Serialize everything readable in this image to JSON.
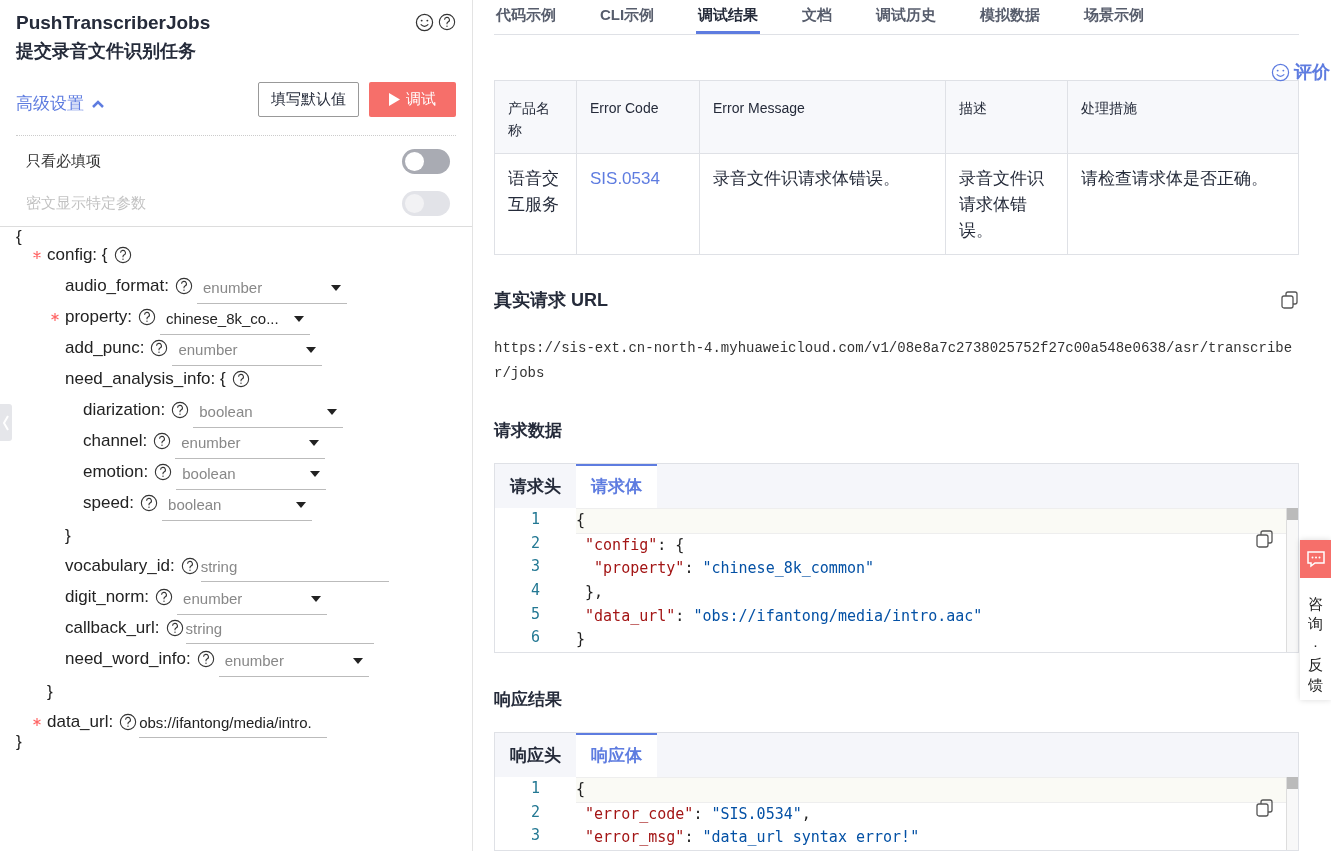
{
  "header": {
    "title": "PushTranscriberJobs",
    "subtitle": "提交录音文件识别任务"
  },
  "advanced": {
    "label": "高级设置",
    "expanded": true
  },
  "buttons": {
    "defaults": "填写默认值",
    "debug": "调试"
  },
  "toggles": [
    {
      "label": "只看必填项",
      "on": false,
      "disabled": false
    },
    {
      "label": "密文显示特定参数",
      "on": false,
      "disabled": true
    }
  ],
  "form": {
    "open": "{",
    "close": "}",
    "fields": [
      {
        "kind": "object",
        "label": "config: {",
        "required": true,
        "close": "}",
        "children": [
          {
            "kind": "select",
            "label": "audio_format:",
            "required": false,
            "placeholder": "enumber"
          },
          {
            "kind": "select",
            "label": "property:",
            "required": true,
            "value": "chinese_8k_co..."
          },
          {
            "kind": "select",
            "label": "add_punc:",
            "required": false,
            "placeholder": "enumber"
          },
          {
            "kind": "object",
            "label": "need_analysis_info: {",
            "required": false,
            "close": "}",
            "children": [
              {
                "kind": "select",
                "label": "diarization:",
                "required": false,
                "placeholder": "boolean"
              },
              {
                "kind": "select",
                "label": "channel:",
                "required": false,
                "placeholder": "enumber"
              },
              {
                "kind": "select",
                "label": "emotion:",
                "required": false,
                "placeholder": "boolean"
              },
              {
                "kind": "select",
                "label": "speed:",
                "required": false,
                "placeholder": "boolean"
              }
            ]
          },
          {
            "kind": "input",
            "label": "vocabulary_id:",
            "required": false,
            "placeholder": "string"
          },
          {
            "kind": "select",
            "label": "digit_norm:",
            "required": false,
            "placeholder": "enumber"
          },
          {
            "kind": "input",
            "label": "callback_url:",
            "required": false,
            "placeholder": "string"
          },
          {
            "kind": "select",
            "label": "need_word_info:",
            "required": false,
            "placeholder": "enumber"
          }
        ]
      },
      {
        "kind": "input",
        "label": "data_url:",
        "required": true,
        "value": "obs://ifantong/media/intro."
      }
    ]
  },
  "tabs": [
    {
      "label": "代码示例",
      "selected": false
    },
    {
      "label": "CLI示例",
      "selected": false
    },
    {
      "label": "调试结果",
      "selected": true
    },
    {
      "label": "文档",
      "selected": false
    },
    {
      "label": "调试历史",
      "selected": false
    },
    {
      "label": "模拟数据",
      "selected": false
    },
    {
      "label": "场景示例",
      "selected": false
    }
  ],
  "rating": "评价",
  "table": {
    "columns": [
      "产品名称",
      "Error Code",
      "Error Message",
      "描述",
      "处理措施"
    ],
    "rows": [
      [
        "语音交互服务",
        "SIS.0534",
        "录音文件识请求体错误。",
        "录音文件识请求体错误。",
        "请检查请求体是否正确。"
      ]
    ]
  },
  "url_section": {
    "title": "真实请求 URL",
    "url": "https://sis-ext.cn-north-4.myhuaweicloud.com/v1/08e8a7c2738025752f27c00a548e0638/asr/transcriber/jobs"
  },
  "request": {
    "title": "请求数据",
    "tabs": [
      {
        "label": "请求头",
        "selected": false
      },
      {
        "label": "请求体",
        "selected": true
      }
    ],
    "lines": [
      {
        "number": "1",
        "tokens": [
          {
            "kind": "punct",
            "text": "{"
          }
        ]
      },
      {
        "number": "2",
        "tokens": [
          {
            "kind": "key",
            "text": " \"config\""
          },
          {
            "kind": "punct",
            "text": ": {"
          }
        ]
      },
      {
        "number": "3",
        "tokens": [
          {
            "kind": "key",
            "text": "  \"property\""
          },
          {
            "kind": "punct",
            "text": ": "
          },
          {
            "kind": "string",
            "text": "\"chinese_8k_common\""
          }
        ]
      },
      {
        "number": "4",
        "tokens": [
          {
            "kind": "punct",
            "text": " },"
          }
        ]
      },
      {
        "number": "5",
        "tokens": [
          {
            "kind": "key",
            "text": " \"data_url\""
          },
          {
            "kind": "punct",
            "text": ": "
          },
          {
            "kind": "string",
            "text": "\"obs://ifantong/media/intro.aac\""
          }
        ]
      },
      {
        "number": "6",
        "tokens": [
          {
            "kind": "punct",
            "text": "}"
          }
        ]
      }
    ]
  },
  "response": {
    "title": "响应结果",
    "tabs": [
      {
        "label": "响应头",
        "selected": false
      },
      {
        "label": "响应体",
        "selected": true
      }
    ],
    "lines": [
      {
        "number": "1",
        "tokens": [
          {
            "kind": "punct",
            "text": "{"
          }
        ]
      },
      {
        "number": "2",
        "tokens": [
          {
            "kind": "key",
            "text": " \"error_code\""
          },
          {
            "kind": "punct",
            "text": ": "
          },
          {
            "kind": "string",
            "text": "\"SIS.0534\""
          },
          {
            "kind": "punct",
            "text": ","
          }
        ]
      },
      {
        "number": "3",
        "tokens": [
          {
            "kind": "key",
            "text": " \"error_msg\""
          },
          {
            "kind": "punct",
            "text": ": "
          },
          {
            "kind": "string",
            "text": "\"data_url syntax error!\""
          }
        ]
      }
    ]
  },
  "feedback": {
    "chars": [
      "咨",
      "询",
      "·",
      "反",
      "馈"
    ]
  }
}
